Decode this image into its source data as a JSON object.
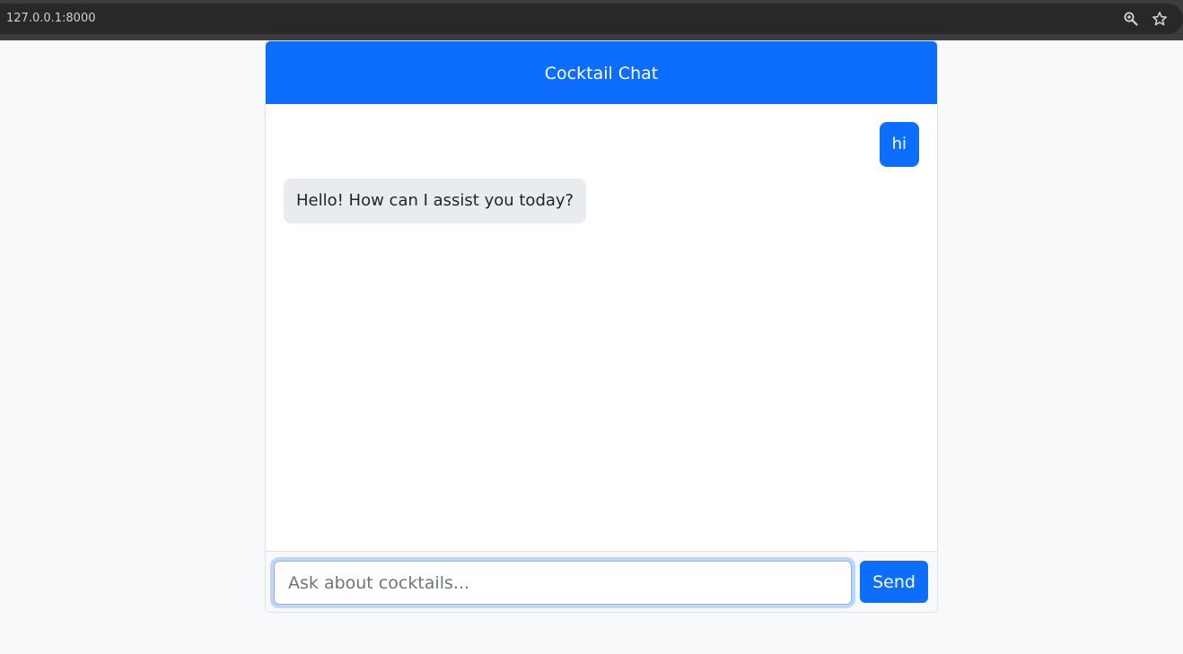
{
  "browser": {
    "url": "127.0.0.1:8000",
    "icons": [
      "zoom-icon",
      "star-icon"
    ]
  },
  "chat": {
    "title": "Cocktail Chat",
    "messages": [
      {
        "role": "user",
        "text": "hi"
      },
      {
        "role": "bot",
        "text": "Hello! How can I assist you today?"
      }
    ],
    "input": {
      "value": "",
      "placeholder": "Ask about cocktails..."
    },
    "send_label": "Send"
  },
  "colors": {
    "primary": "#0d6efd",
    "bot_bubble": "#e9ecef",
    "page_bg": "#f8f9fa"
  }
}
